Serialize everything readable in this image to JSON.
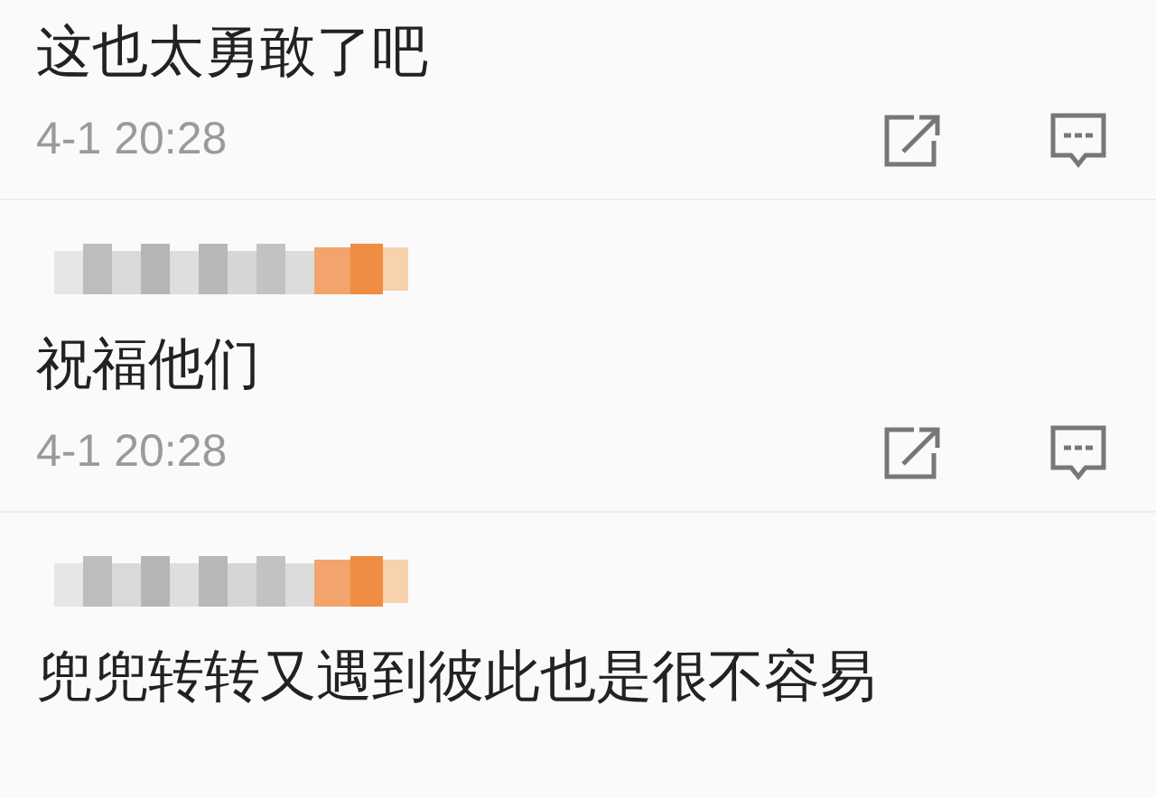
{
  "comments": [
    {
      "author_pixelated": false,
      "text": "这也太勇敢了吧",
      "time": "4-1 20:28"
    },
    {
      "author_pixelated": true,
      "text": "祝福他们",
      "time": "4-1 20:28"
    },
    {
      "author_pixelated": true,
      "text": "兜兜转转又遇到彼此也是很不容易"
    }
  ]
}
